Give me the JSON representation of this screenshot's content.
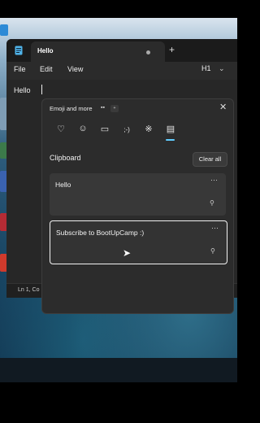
{
  "notepad": {
    "tab_title": "Hello",
    "new_tab": "+",
    "menu": [
      "File",
      "Edit",
      "View"
    ],
    "heading_select": "H1",
    "editor_text": "Hello",
    "status": "Ln 1, Co"
  },
  "panel": {
    "title": "Emoji and more",
    "close": "✕",
    "categories": [
      {
        "icon": "emoji-favorites-icon",
        "glyph": "♡"
      },
      {
        "icon": "smiley-icon",
        "glyph": "☺"
      },
      {
        "icon": "gif-icon",
        "glyph": "▭"
      },
      {
        "icon": "kaomoji-icon",
        "glyph": ";-)"
      },
      {
        "icon": "symbols-icon",
        "glyph": "※"
      },
      {
        "icon": "clipboard-icon",
        "glyph": "▤"
      }
    ],
    "clipboard_heading": "Clipboard",
    "clear_all": "Clear all",
    "items": [
      {
        "text": "Hello",
        "more": "···",
        "pin": "⚲"
      },
      {
        "text": "Subscribe to BootUpCamp :)",
        "more": "···",
        "pin": "⚲"
      }
    ]
  },
  "colors": {
    "accent": "#60cdff",
    "panel_bg": "#2c2c2c",
    "window_bg": "#202020"
  }
}
